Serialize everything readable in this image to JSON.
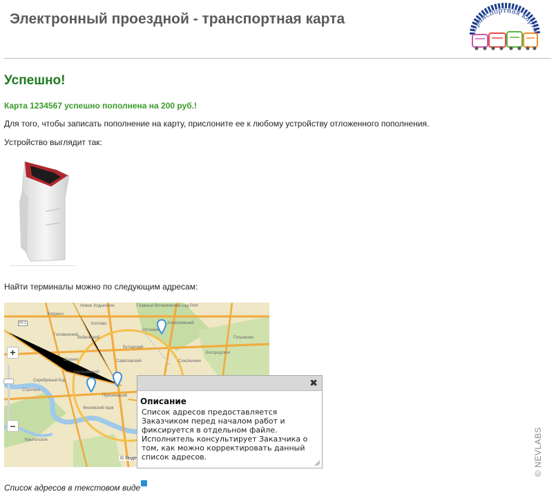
{
  "header": {
    "title": "Электронный проездной - транспортная карта",
    "logo_text": "транспортная карта"
  },
  "status": {
    "title": "Успешно!",
    "message": "Карта 1234567 успешно пополнена на 200 руб.!"
  },
  "content": {
    "instruction": "Для того, чтобы записать пополнение на карту, прислоните ее к любому устройству отложенного пополнения.",
    "device_caption": "Устройство выглядит так:",
    "addresses_caption": "Найти терминалы можно по следующим адресам:"
  },
  "map": {
    "zoom_in": "+",
    "zoom_out": "–",
    "attribution": "© Яндекс",
    "labels": [
      "Новое Ходынское",
      "Главный ботанический сад РАН",
      "Останкино",
      "Алексеевский",
      "Головинский",
      "Войковский",
      "Ховрино",
      "Коптево",
      "Бутырский",
      "Богородское",
      "Гольяново",
      "Савёловский",
      "Щукино",
      "Сокольники",
      "Хорошёвский",
      "Серебряный Бор",
      "Пресненский",
      "Филевский парк",
      "Строгино",
      "Крылатское",
      "М-1"
    ]
  },
  "popup": {
    "close": "✖",
    "title": "Описание",
    "body": "Список адресов предоставляется Заказчиком перед началом работ и фиксируется в отдельном файле. Исполнитель консультирует Заказчика о том, как можно корректировать данный список адресов."
  },
  "footer": {
    "list_link": "Список адресов  в текстовом виде"
  },
  "watermark": "© NEVLABS",
  "colors": {
    "success_title": "#1f7a1f",
    "success_msg": "#3a9a2a",
    "map_bg": "#efe7c6",
    "road": "#f2a93b",
    "water": "#9ec9e8",
    "park": "#c5dca4",
    "pin": "#3a8fd8"
  }
}
